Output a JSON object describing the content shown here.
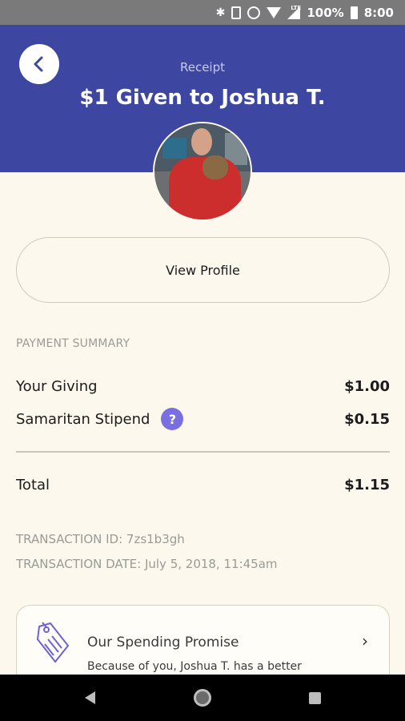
{
  "status_bar": {
    "battery": "100%",
    "time": "8:00",
    "network": "LTE",
    "icons": [
      "bluetooth-icon",
      "vibrate-icon",
      "alarm-icon",
      "wifi-icon",
      "cell-signal-icon",
      "battery-icon"
    ]
  },
  "header": {
    "label": "Receipt",
    "title": "$1 Given to Joshua T.",
    "color": "#3d46a0"
  },
  "profile": {
    "view_profile_label": "View Profile"
  },
  "payment_summary": {
    "section_label": "PAYMENT SUMMARY",
    "giving_label": "Your Giving",
    "giving_value": "$1.00",
    "stipend_label": "Samaritan Stipend",
    "stipend_value": "$0.15",
    "help_icon_text": "?",
    "total_label": "Total",
    "total_value": "$1.15"
  },
  "transaction": {
    "id_line": "TRANSACTION ID: 7zs1b3gh",
    "date_line": "TRANSACTION DATE: July 5, 2018, 11:45am"
  },
  "promise_card": {
    "title": "Our Spending Promise",
    "body": "Because of you, Joshua T. has a better",
    "chevron": "›"
  },
  "colors": {
    "accent": "#7a6fe0",
    "background": "#fcf8ee"
  }
}
